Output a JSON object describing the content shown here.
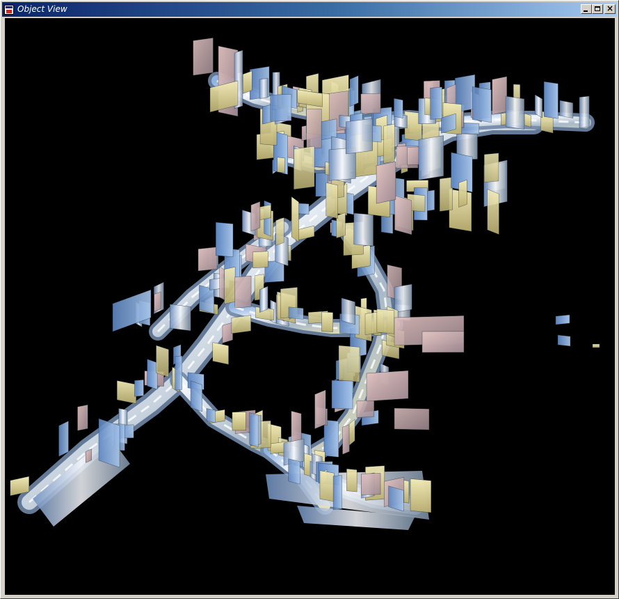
{
  "window": {
    "title": "Object View",
    "minimize_icon": "minimize-icon",
    "maximize_icon": "maximize-icon",
    "close_icon": "close-icon",
    "close_glyph": "×"
  },
  "colors": {
    "titlebar_start": "#0a246a",
    "titlebar_end": "#a6caf0",
    "viewport_background": "#000000",
    "model_blue": "#7fa7d9",
    "model_yellow": "#e8e0a0",
    "model_pink": "#d8b8b8",
    "model_white": "#eef4fa"
  }
}
